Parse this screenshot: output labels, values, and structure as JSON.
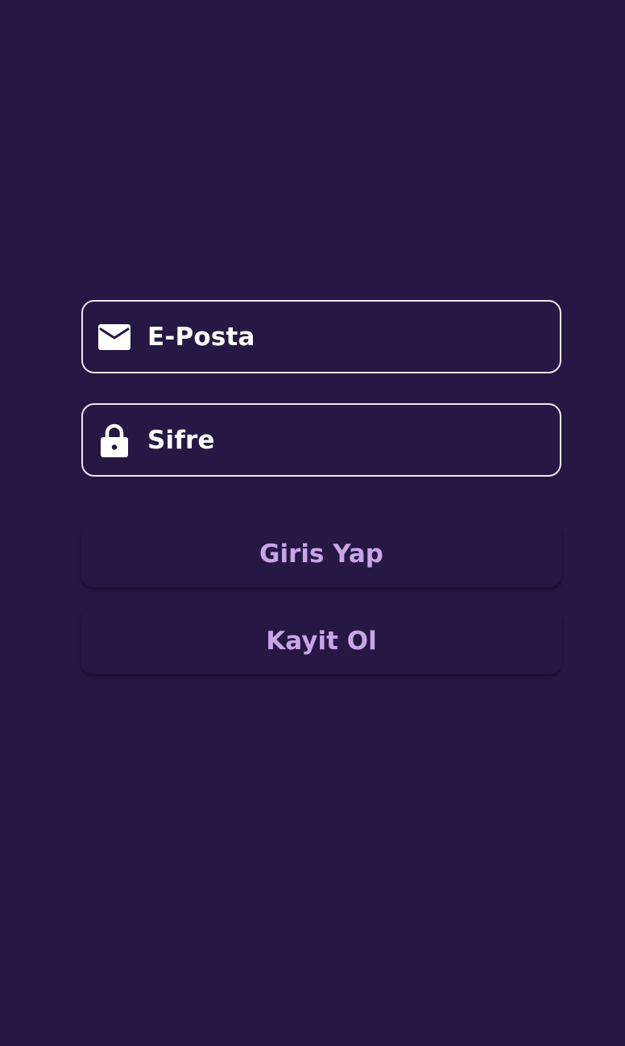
{
  "form": {
    "email_placeholder": "E-Posta",
    "email_icon": "envelope-icon",
    "password_placeholder": "Sifre",
    "password_icon": "lock-icon"
  },
  "actions": {
    "login_label": "Giris Yap",
    "register_label": "Kayit Ol"
  },
  "colors": {
    "background": "#261744",
    "field_border": "#ece8f2",
    "field_text": "#ffffff",
    "button_text": "#c8a6e6"
  }
}
